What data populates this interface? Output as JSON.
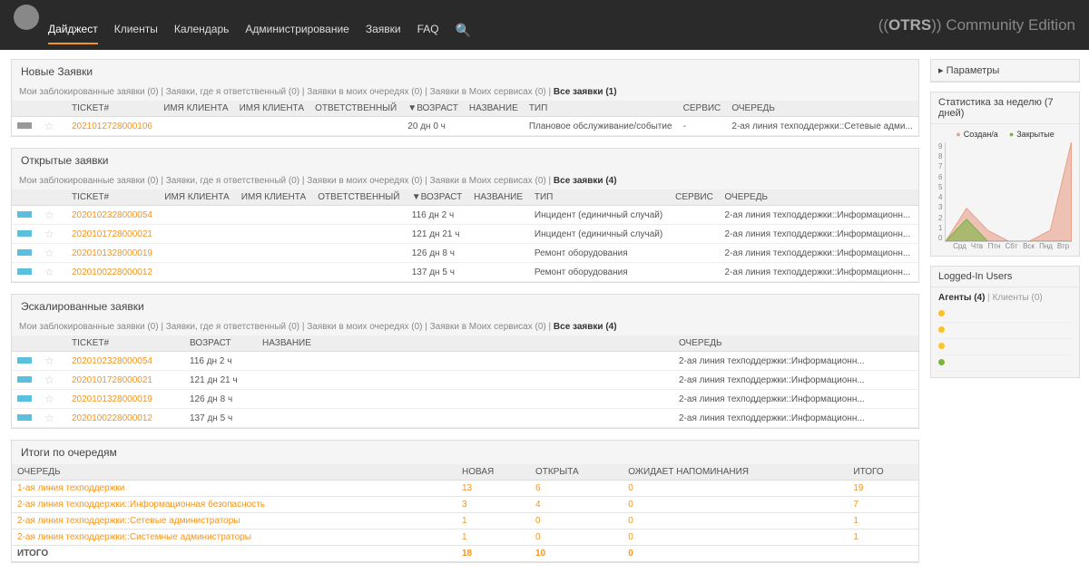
{
  "brand": {
    "prefix": "((",
    "name": "OTRS",
    "suffix": "))",
    "tag": "Community Edition"
  },
  "nav": [
    "Дайджест",
    "Клиенты",
    "Календарь",
    "Администрирование",
    "Заявки",
    "FAQ"
  ],
  "filters_line": "Мои заблокированные заявки (0)  |  Заявки, где я ответственный (0)  |  Заявки в моих очередях (0)  |  Заявки в Моих сервисах (0)  |  ",
  "new": {
    "title": "Новые Заявки",
    "all": "Все заявки (1)",
    "cols": [
      "TICKET#",
      "ИМЯ КЛИЕНТА",
      "ИМЯ КЛИЕНТА",
      "ОТВЕТСТВЕННЫЙ",
      "▼ВОЗРАСТ",
      "НАЗВАНИЕ",
      "ТИП",
      "СЕРВИС",
      "ОЧЕРЕДЬ"
    ],
    "rows": [
      {
        "t": "2021012728000106",
        "age": "20 дн 0 ч",
        "name": "",
        "type": "Плановое обслуживание/событие",
        "svc": "-",
        "q": "2-ая линия техподдержки::Сетевые адми..."
      }
    ]
  },
  "open": {
    "title": "Открытые заявки",
    "all": "Все заявки (4)",
    "cols": [
      "TICKET#",
      "ИМЯ КЛИЕНТА",
      "ИМЯ КЛИЕНТА",
      "ОТВЕТСТВЕННЫЙ",
      "▼ВОЗРАСТ",
      "НАЗВАНИЕ",
      "ТИП",
      "СЕРВИС",
      "ОЧЕРЕДЬ"
    ],
    "rows": [
      {
        "t": "2020102328000054",
        "age": "116 дн 2 ч",
        "type": "Инцидент (единичный случай)",
        "q": "2-ая линия техподдержки::Информационн..."
      },
      {
        "t": "2020101728000021",
        "age": "121 дн 21 ч",
        "type": "Инцидент (единичный случай)",
        "q": "2-ая линия техподдержки::Информационн..."
      },
      {
        "t": "2020101328000019",
        "age": "126 дн 8 ч",
        "type": "Ремонт оборудования",
        "q": "2-ая линия техподдержки::Информационн..."
      },
      {
        "t": "2020100228000012",
        "age": "137 дн 5 ч",
        "type": "Ремонт оборудования",
        "q": "2-ая линия техподдержки::Информационн..."
      }
    ]
  },
  "esc": {
    "title": "Эскалированные заявки",
    "all": "Все заявки (4)",
    "cols": [
      "TICKET#",
      "ВОЗРАСТ",
      "НАЗВАНИЕ",
      "ОЧЕРЕДЬ"
    ],
    "rows": [
      {
        "t": "2020102328000054",
        "age": "116 дн 2 ч",
        "q": "2-ая линия техподдержки::Информационн..."
      },
      {
        "t": "2020101728000021",
        "age": "121 дн 21 ч",
        "q": "2-ая линия техподдержки::Информационн..."
      },
      {
        "t": "2020101328000019",
        "age": "126 дн 8 ч",
        "q": "2-ая линия техподдержки::Информационн..."
      },
      {
        "t": "2020100228000012",
        "age": "137 дн 5 ч",
        "q": "2-ая линия техподдержки::Информационн..."
      }
    ]
  },
  "totals": {
    "title": "Итоги по очередям",
    "cols": [
      "ОЧЕРЕДЬ",
      "НОВАЯ",
      "ОТКРЫТА",
      "ОЖИДАЕТ НАПОМИНАНИЯ",
      "ИТОГО"
    ],
    "rows": [
      {
        "q": "1-ая линия техподдержки",
        "n": "13",
        "o": "6",
        "w": "0",
        "t": "19"
      },
      {
        "q": "2-ая линия техподдержки::Информационная безопасность",
        "n": "3",
        "o": "4",
        "w": "0",
        "t": "7"
      },
      {
        "q": "2-ая линия техподдержки::Сетевые администраторы",
        "n": "1",
        "o": "0",
        "w": "0",
        "t": "1"
      },
      {
        "q": "2-ая линия техподдержки::Системные администраторы",
        "n": "1",
        "o": "0",
        "w": "0",
        "t": "1"
      }
    ],
    "sum": {
      "q": "ИТОГО",
      "n": "18",
      "o": "10",
      "w": "0",
      "t": ""
    }
  },
  "side": {
    "params": "Параметры",
    "stats_title": "Статистика за неделю (7 дней)",
    "legend": {
      "c": "Создан/а",
      "z": "Закрытые"
    },
    "logged": "Logged-In Users",
    "agents": "Агенты (4)",
    "clients": "Клиенты (0)",
    "user_colors": [
      "#fbc02d",
      "#fbc02d",
      "#fbc02d",
      "#7cb342"
    ]
  },
  "chart_data": {
    "type": "area",
    "categories": [
      "Срд",
      "Чтв",
      "Птн",
      "Сбт",
      "Вск",
      "Пнд",
      "Втр"
    ],
    "series": [
      {
        "name": "Создан/а",
        "values": [
          0,
          3,
          1,
          0,
          0,
          1,
          9
        ],
        "color": "#e8a08a"
      },
      {
        "name": "Закрытые",
        "values": [
          0,
          2,
          0,
          0,
          0,
          0,
          0
        ],
        "color": "#7cb342"
      }
    ],
    "ylim": [
      0,
      9
    ],
    "yticks": [
      0,
      1,
      2,
      3,
      4,
      5,
      6,
      7,
      8,
      9
    ]
  }
}
